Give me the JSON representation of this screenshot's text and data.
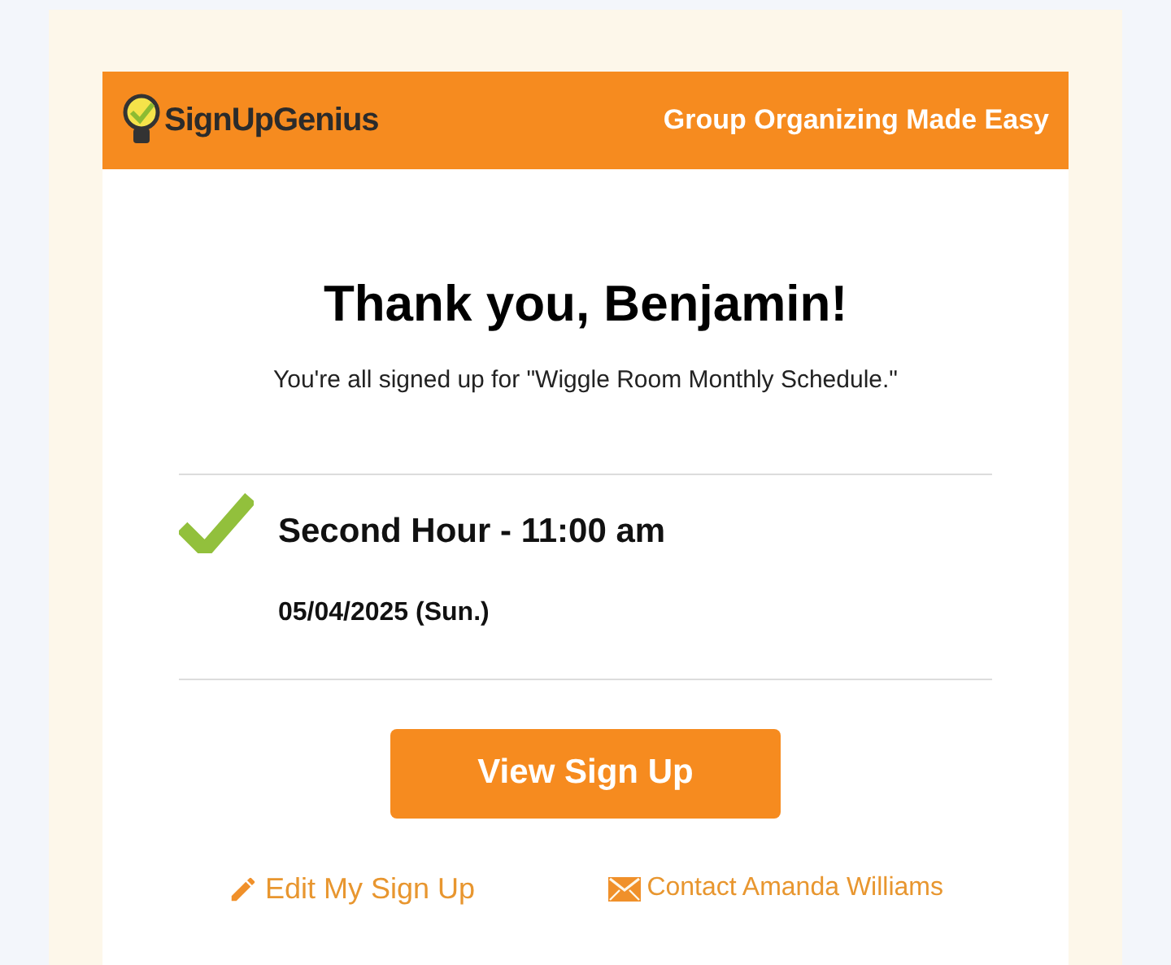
{
  "header": {
    "logo_text": "SignUpGenius",
    "tagline": "Group Organizing Made Easy"
  },
  "title": "Thank you, Benjamin!",
  "subtitle": "You're all signed up for \"Wiggle Room Monthly Schedule.\"",
  "slots": [
    {
      "name": "Second Hour - 11:00 am",
      "date": "05/04/2025 (Sun.)",
      "checked": true
    }
  ],
  "primary_button": "View Sign Up",
  "links": [
    {
      "kind": "edit",
      "label": "Edit My Sign Up"
    },
    {
      "kind": "contact",
      "label": "Contact Amanda Williams"
    }
  ]
}
